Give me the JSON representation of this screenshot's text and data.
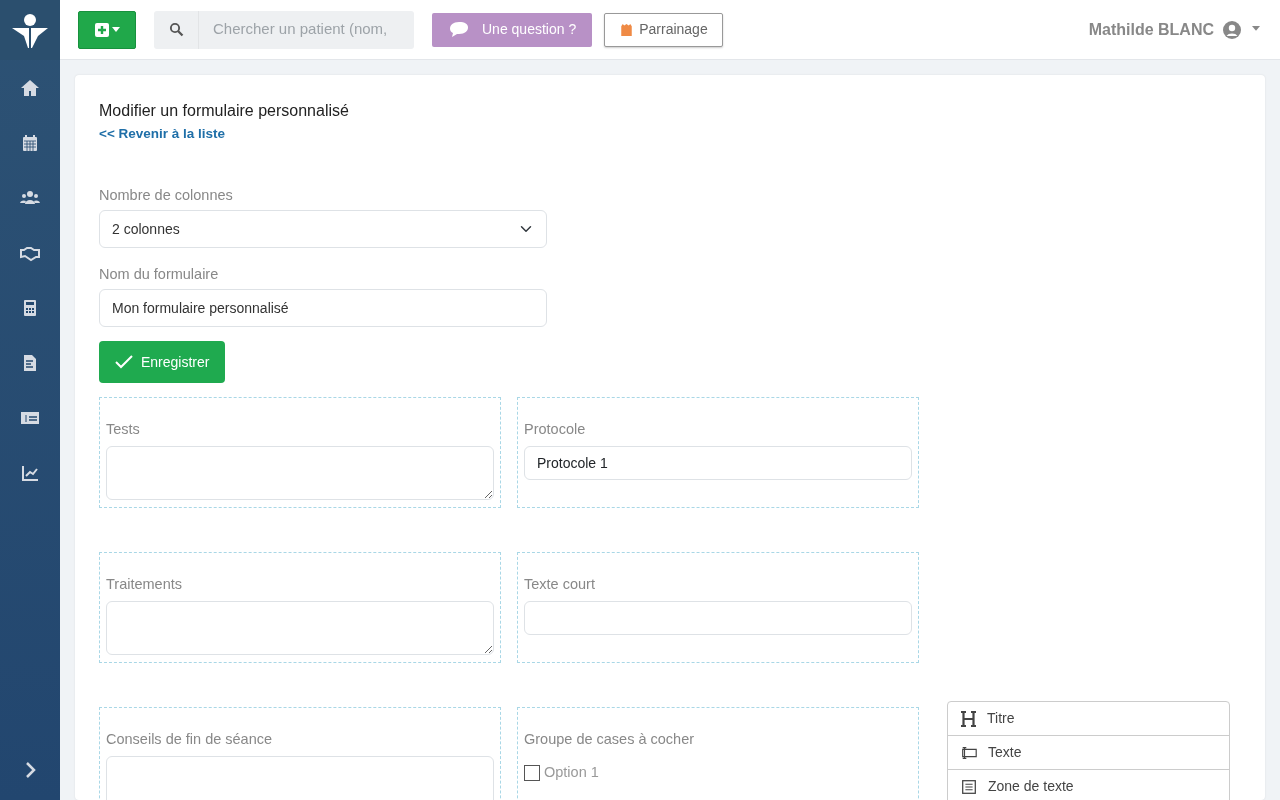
{
  "topbar": {
    "search": {
      "placeholder": "Chercher un patient (nom,"
    },
    "question_button": "Une question ?",
    "referral_button": "Parrainage",
    "user": "Mathilde BLANC"
  },
  "page": {
    "title": "Modifier un formulaire personnalisé",
    "back_link": "<< Revenir à la liste",
    "columns_field": {
      "label": "Nombre de colonnes",
      "value": "2 colonnes"
    },
    "name_field": {
      "label": "Nom du formulaire",
      "value": "Mon formulaire personnalisé"
    },
    "save_button": "Enregistrer",
    "fields": [
      {
        "kind": "textarea",
        "label": "Tests"
      },
      {
        "kind": "input",
        "label": "Protocole",
        "value": "Protocole 1"
      },
      {
        "kind": "textarea",
        "label": "Traitements"
      },
      {
        "kind": "input",
        "label": "Texte court"
      },
      {
        "kind": "textarea",
        "label": "Conseils de fin de séance"
      },
      {
        "kind": "checkboxes",
        "label": "Groupe de cases à cocher",
        "options": [
          {
            "label": "Option 1",
            "checked": false
          }
        ]
      }
    ],
    "toolbox": [
      {
        "kind": "heading",
        "label": "Titre"
      },
      {
        "kind": "input",
        "label": "Texte"
      },
      {
        "kind": "textarea",
        "label": "Zone de texte"
      }
    ]
  }
}
